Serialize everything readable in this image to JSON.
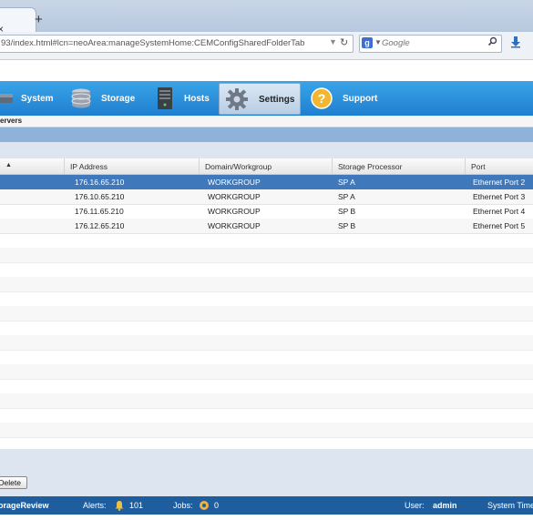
{
  "browser": {
    "tab_close": "×",
    "new_tab": "+",
    "url": "93/index.html#lcn=neoArea:manageSystemHome:CEMConfigSharedFolderTab",
    "search_placeholder": "Google",
    "search_engine": "g"
  },
  "mainnav": {
    "items": [
      {
        "label": "System",
        "icon": "system-icon"
      },
      {
        "label": "Storage",
        "icon": "storage-icon"
      },
      {
        "label": "Hosts",
        "icon": "hosts-icon"
      },
      {
        "label": "Settings",
        "icon": "gear-icon",
        "active": true
      },
      {
        "label": "Support",
        "icon": "help-icon"
      }
    ]
  },
  "subheader": {
    "title": "ervers"
  },
  "grid": {
    "columns": [
      "",
      "IP Address",
      "Domain/Workgroup",
      "Storage Processor",
      "Port"
    ],
    "sort_indicator": "▲",
    "rows": [
      {
        "ip": "176.16.65.210",
        "domain": "WORKGROUP",
        "sp": "SP A",
        "port": "Ethernet Port 2",
        "selected": true
      },
      {
        "ip": "176.10.65.210",
        "domain": "WORKGROUP",
        "sp": "SP A",
        "port": "Ethernet Port 3"
      },
      {
        "ip": "176.11.65.210",
        "domain": "WORKGROUP",
        "sp": "SP B",
        "port": "Ethernet Port 4"
      },
      {
        "ip": "176.12.65.210",
        "domain": "WORKGROUP",
        "sp": "SP B",
        "port": "Ethernet Port 5"
      }
    ]
  },
  "footer": {
    "delete_label": "Delete"
  },
  "statusbar": {
    "brand": "orageReview",
    "alerts_label": "Alerts:",
    "alerts_count": "101",
    "jobs_label": "Jobs:",
    "jobs_count": "0",
    "user_label": "User:",
    "user_name": "admin",
    "time_label": "System Time"
  },
  "colors": {
    "accent": "#2a8fe0",
    "selected_row": "#3f78bb",
    "statusbar": "#1f5e9e"
  }
}
